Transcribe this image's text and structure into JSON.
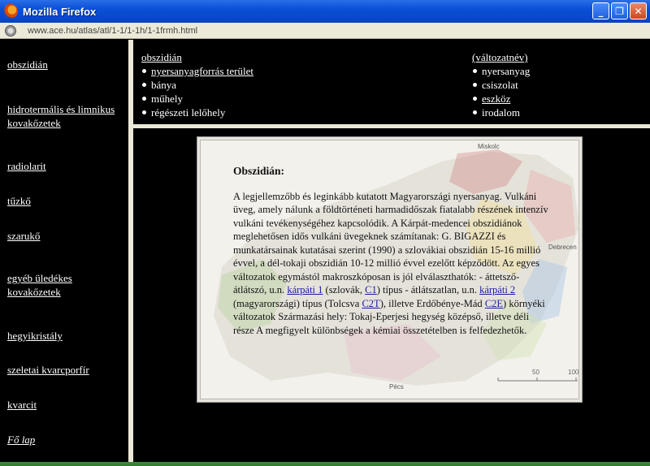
{
  "window": {
    "title": "Mozilla Firefox",
    "minimize": "_",
    "maximize": "❐",
    "close": "✕",
    "url": "www.ace.hu/atlas/atl/1-1/1-1h/1-1frmh.html"
  },
  "sidebar": {
    "items": [
      "obszidián",
      "hidrotermális és limnikus kovakőzetek",
      "radiolarit",
      "tűzkő",
      "szarukő",
      "egyéb üledékes kovakőzetek",
      "hegyikristály",
      "szeletai kvarcporfír",
      "kvarcit",
      "Fő lap"
    ]
  },
  "topnav": {
    "left_head": "obszidián",
    "left_items": [
      "nyersanyagforrás terület",
      "bánya",
      "műhely",
      "régészeti lelőhely"
    ],
    "right_head": "(változatnév)",
    "right_items": [
      "nyersanyag",
      "csiszolat",
      "eszköz",
      "irodalom"
    ]
  },
  "card": {
    "title": "Obszidián:",
    "p1": "A legjellemzőbb és leginkább kutatott Magyarországi nyersanyag. Vulkáni üveg, amely nálunk a földtörténeti harmadidőszak fiatalabb részének intenzív vulkáni tevékenységéhez kapcsolódik. A Kárpát-medencei obszidiánok meglehetősen idős vulkáni üvegeknek számítanak: G. BIGAZZI és munkatársainak kutatásai szerint (1990) a szlovákiai obszidián 15-16 millió évvel, a dél-tokaji obszidián 10-12 millió évvel ezelőtt képződött. Az egyes változatok egymástól makroszkóposan is jól elválaszthatók: - áttetsző-átlátszó, u.n. ",
    "link1": "kárpáti 1",
    "p2": " (szlovák, ",
    "link2": "C1",
    "p3": ") típus - átlátszatlan, u.n. ",
    "link3": "kárpáti 2",
    "p4": " (magyarországi) típus (Tolcsva ",
    "link4": "C2T",
    "p5": "), illetve Erdőbénye-Mád ",
    "link5": "C2E",
    "p6": ") környéki változatok Származási hely: Tokaj-Eperjesi hegység középső, illetve déli része A megfigyelt különbségek a kémiai összetételben is felfedezhetők.",
    "map_labels": [
      "Miskolc",
      "Debrecen",
      "Pécs",
      "50",
      "100"
    ]
  }
}
